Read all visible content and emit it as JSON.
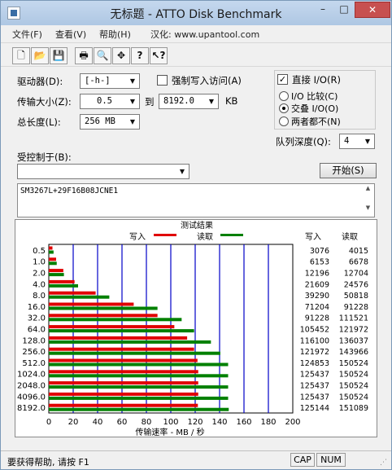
{
  "window": {
    "title": "无标题 - ATTO Disk Benchmark",
    "min_label": "–",
    "max_label": "□",
    "close_label": "✕"
  },
  "menu": {
    "file": "文件(F)",
    "view": "查看(V)",
    "help": "帮助(H)",
    "localized_by": "汉化: www.upantool.com"
  },
  "toolbar": {
    "buttons": [
      {
        "name": "new-icon",
        "glyph": "🗋"
      },
      {
        "name": "open-folder-icon",
        "glyph": "📂"
      },
      {
        "name": "save-icon",
        "glyph": "💾"
      },
      {
        "name": "print-icon",
        "glyph": "🖶"
      },
      {
        "name": "print-preview-icon",
        "glyph": "🔍"
      },
      {
        "name": "move-icon",
        "glyph": "✥"
      },
      {
        "name": "about-icon",
        "glyph": "?"
      },
      {
        "name": "context-help-icon",
        "glyph": "↖?"
      }
    ]
  },
  "settings": {
    "drive_label": "驱动器(D):",
    "drive_value": "[-h-]",
    "force_write_label": "强制写入访问(A)",
    "force_write_checked": false,
    "transfer_size_label": "传输大小(Z):",
    "transfer_from": "0.5",
    "to_label": "到",
    "transfer_to": "8192.0",
    "kb_label": "KB",
    "total_length_label": "总长度(L):",
    "total_length_value": "256 MB",
    "direct_io_label": "直接 I/O(R)",
    "direct_io_checked": true,
    "io_options": [
      {
        "label": "I/O 比较(C)",
        "selected": false
      },
      {
        "label": "交叠 I/O(O)",
        "selected": true
      },
      {
        "label": "两者都不(N)",
        "selected": false
      }
    ],
    "queue_depth_label": "队列深度(Q):",
    "queue_depth_value": "4",
    "controlled_by_label": "受控制于(B):",
    "controlled_by_value": "",
    "start_button": "开始(S)",
    "description": "SM3267L+29F16B08JCNE1"
  },
  "results": {
    "title": "测试结果",
    "write_label": "写入",
    "read_label": "读取",
    "col_write": "写入",
    "col_read": "读取",
    "xlabel": "传输速率 - MB / 秒"
  },
  "chart_data": {
    "type": "bar",
    "orientation": "horizontal",
    "title": "测试结果",
    "xlabel": "传输速率 - MB / 秒",
    "xlim": [
      0,
      200
    ],
    "xticks": [
      0,
      20,
      40,
      60,
      80,
      100,
      120,
      140,
      160,
      180,
      200
    ],
    "grid": true,
    "legend_placement": "top",
    "categories": [
      "0.5",
      "1.0",
      "2.0",
      "4.0",
      "8.0",
      "16.0",
      "32.0",
      "64.0",
      "128.0",
      "256.0",
      "512.0",
      "1024.0",
      "2048.0",
      "4096.0",
      "8192.0"
    ],
    "series": [
      {
        "name": "写入",
        "color": "#e00000",
        "values": [
          3.0,
          6.0,
          11.9,
          21.1,
          38.4,
          69.6,
          89.1,
          102.9,
          113.4,
          119.1,
          121.9,
          122.5,
          122.5,
          122.5,
          122.2
        ],
        "labels": [
          "3076",
          "6153",
          "12196",
          "21609",
          "39290",
          "71204",
          "91228",
          "105452",
          "116100",
          "121972",
          "124853",
          "125437",
          "125437",
          "125437",
          "125144"
        ]
      },
      {
        "name": "读取",
        "color": "#008000",
        "values": [
          3.9,
          6.5,
          12.4,
          24.0,
          49.6,
          89.1,
          108.9,
          119.1,
          132.9,
          140.6,
          147.0,
          147.0,
          147.0,
          147.0,
          147.5
        ],
        "labels": [
          "4015",
          "6678",
          "12704",
          "24576",
          "50818",
          "91228",
          "111521",
          "121972",
          "136037",
          "143966",
          "150524",
          "150524",
          "150524",
          "150524",
          "151089"
        ]
      }
    ]
  },
  "status": {
    "help_text": "要获得帮助, 请按 F1",
    "cap": "CAP",
    "num": "NUM"
  }
}
